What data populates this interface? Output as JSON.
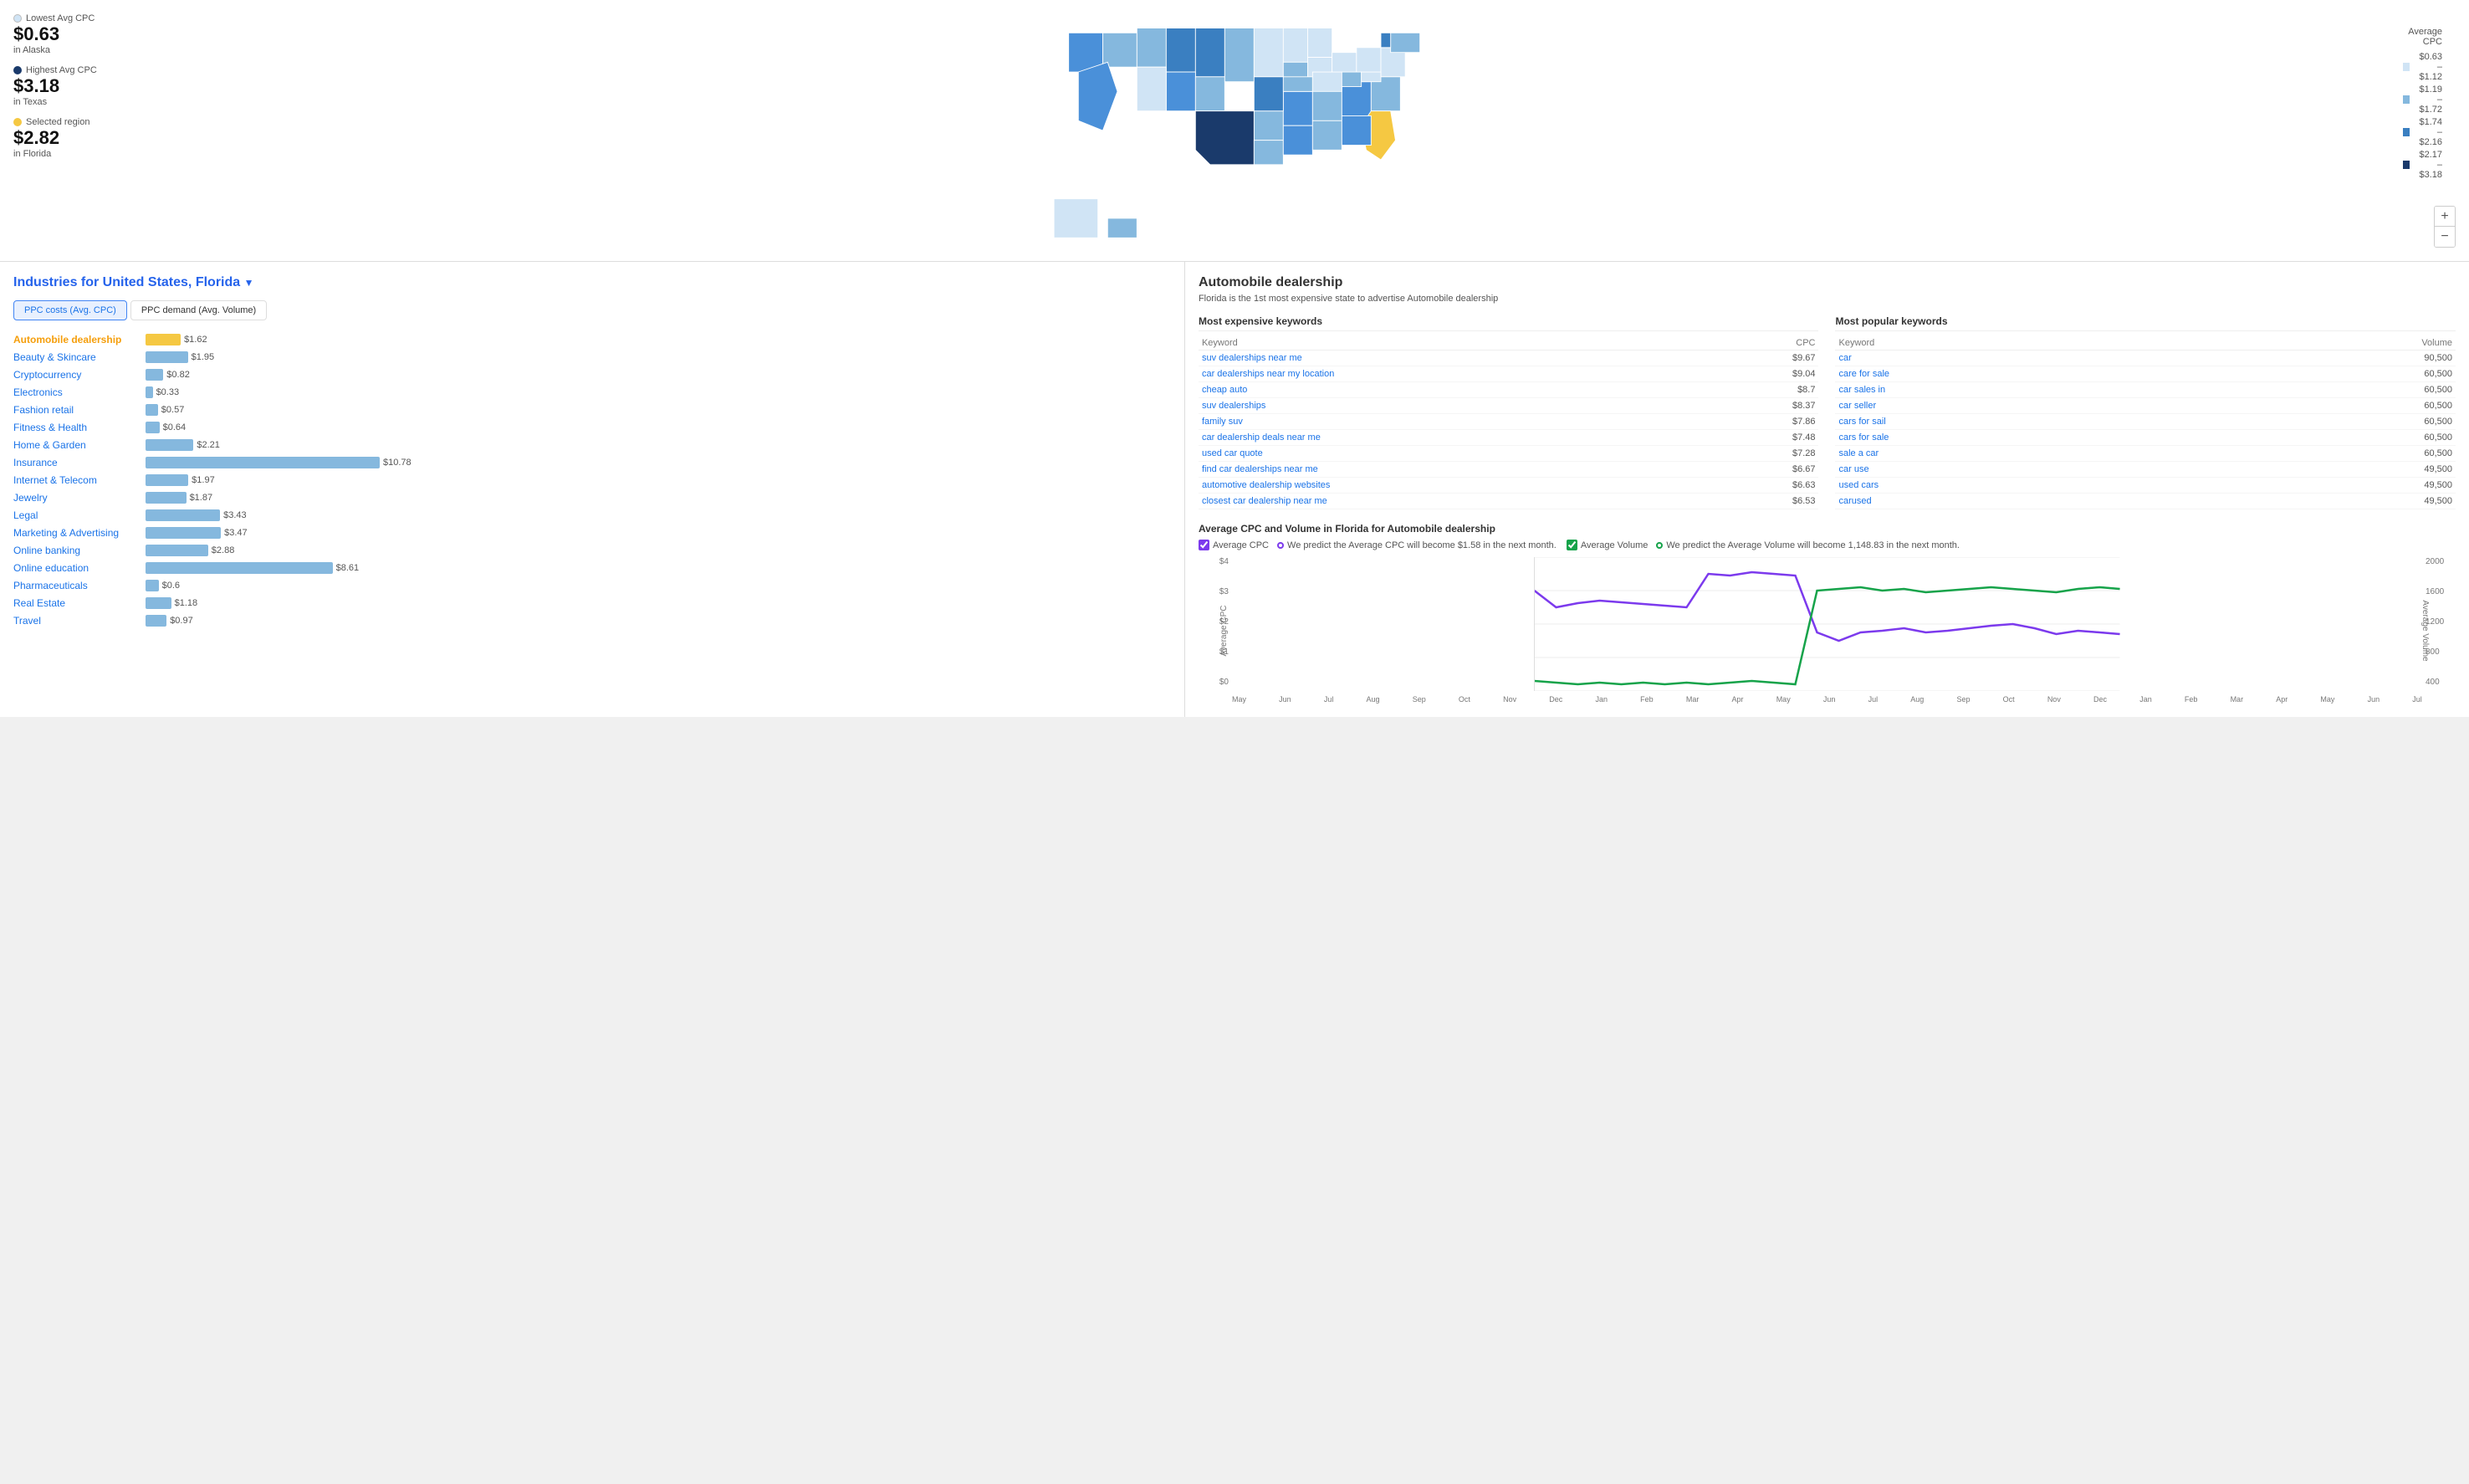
{
  "map": {
    "lowest_label": "Lowest Avg CPC",
    "lowest_value": "$0.63",
    "lowest_location": "in Alaska",
    "highest_label": "Highest Avg CPC",
    "highest_value": "$3.18",
    "highest_location": "in Texas",
    "selected_label": "Selected region",
    "selected_value": "$2.82",
    "selected_location": "in Florida",
    "legend_title": "Average CPC",
    "legend_items": [
      {
        "color": "#d0e4f5",
        "label": "$0.63 – $1.12"
      },
      {
        "color": "#85b8de",
        "label": "$1.19 – $1.72"
      },
      {
        "color": "#3a7fc1",
        "label": "$1.74 – $2.16"
      },
      {
        "color": "#1a3a6b",
        "label": "$2.17 – $3.18"
      }
    ],
    "zoom_plus": "+",
    "zoom_minus": "−"
  },
  "industries": {
    "title": "Industries for United States,",
    "location": "Florida",
    "tab1": "PPC costs (Avg. CPC)",
    "tab2": "PPC demand (Avg. Volume)",
    "items": [
      {
        "name": "Automobile dealership",
        "value": 1.62,
        "label": "$1.62",
        "active": true
      },
      {
        "name": "Beauty & Skincare",
        "value": 1.95,
        "label": "$1.95"
      },
      {
        "name": "Cryptocurrency",
        "value": 0.82,
        "label": "$0.82"
      },
      {
        "name": "Electronics",
        "value": 0.33,
        "label": "$0.33"
      },
      {
        "name": "Fashion retail",
        "value": 0.57,
        "label": "$0.57"
      },
      {
        "name": "Fitness & Health",
        "value": 0.64,
        "label": "$0.64"
      },
      {
        "name": "Home & Garden",
        "value": 2.21,
        "label": "$2.21"
      },
      {
        "name": "Insurance",
        "value": 10.78,
        "label": "$10.78",
        "is_max": true
      },
      {
        "name": "Internet & Telecom",
        "value": 1.97,
        "label": "$1.97"
      },
      {
        "name": "Jewelry",
        "value": 1.87,
        "label": "$1.87"
      },
      {
        "name": "Legal",
        "value": 3.43,
        "label": "$3.43"
      },
      {
        "name": "Marketing & Advertising",
        "value": 3.47,
        "label": "$3.47"
      },
      {
        "name": "Online banking",
        "value": 2.88,
        "label": "$2.88"
      },
      {
        "name": "Online education",
        "value": 8.61,
        "label": "$8.61"
      },
      {
        "name": "Pharmaceuticals",
        "value": 0.6,
        "label": "$0.6"
      },
      {
        "name": "Real Estate",
        "value": 1.18,
        "label": "$1.18"
      },
      {
        "name": "Travel",
        "value": 0.97,
        "label": "$0.97"
      }
    ],
    "max_value": 10.78
  },
  "detail": {
    "title": "Automobile dealership",
    "subtitle": "Florida is the 1st most expensive state to advertise Automobile dealership",
    "expensive_title": "Most expensive keywords",
    "popular_title": "Most popular keywords",
    "expensive_headers": [
      "Keyword",
      "CPC"
    ],
    "popular_headers": [
      "Keyword",
      "Volume"
    ],
    "expensive_keywords": [
      {
        "keyword": "suv dealerships near me",
        "cpc": "$9.67"
      },
      {
        "keyword": "car dealerships near my location",
        "cpc": "$9.04"
      },
      {
        "keyword": "cheap auto",
        "cpc": "$8.7"
      },
      {
        "keyword": "suv dealerships",
        "cpc": "$8.37"
      },
      {
        "keyword": "family suv",
        "cpc": "$7.86"
      },
      {
        "keyword": "car dealership deals near me",
        "cpc": "$7.48"
      },
      {
        "keyword": "used car quote",
        "cpc": "$7.28"
      },
      {
        "keyword": "find car dealerships near me",
        "cpc": "$6.67"
      },
      {
        "keyword": "automotive dealership websites",
        "cpc": "$6.63"
      },
      {
        "keyword": "closest car dealership near me",
        "cpc": "$6.53"
      }
    ],
    "popular_keywords": [
      {
        "keyword": "car",
        "volume": "90,500"
      },
      {
        "keyword": "care for sale",
        "volume": "60,500"
      },
      {
        "keyword": "car sales in",
        "volume": "60,500"
      },
      {
        "keyword": "car seller",
        "volume": "60,500"
      },
      {
        "keyword": "cars for sail",
        "volume": "60,500"
      },
      {
        "keyword": "cars for sale",
        "volume": "60,500"
      },
      {
        "keyword": "sale a car",
        "volume": "60,500"
      },
      {
        "keyword": "car use",
        "volume": "49,500"
      },
      {
        "keyword": "used cars",
        "volume": "49,500"
      },
      {
        "keyword": "carused",
        "volume": "49,500"
      }
    ],
    "chart_title": "Average CPC and Volume in Florida for Automobile dealership",
    "legend_avg_cpc": "Average CPC",
    "legend_avg_vol": "Average Volume",
    "predict_cpc": "We predict the Average CPC will become $1.58 in the next month.",
    "predict_vol": "We predict the Average Volume will become 1,148.83 in the next month.",
    "x_labels": [
      "May",
      "Jun",
      "Jul",
      "Aug",
      "Sep",
      "Oct",
      "Nov",
      "Dec",
      "Jan",
      "Feb",
      "Mar",
      "Apr",
      "May",
      "Jun",
      "Jul",
      "Aug",
      "Sep",
      "Oct",
      "Nov",
      "Dec",
      "Jan",
      "Feb",
      "Mar",
      "Apr",
      "May",
      "Jun",
      "Jul"
    ],
    "y_left_labels": [
      "$4",
      "$3",
      "$2",
      "$1",
      "$0"
    ],
    "y_right_labels": [
      "2000",
      "1600",
      "1200",
      "800",
      "400"
    ]
  }
}
